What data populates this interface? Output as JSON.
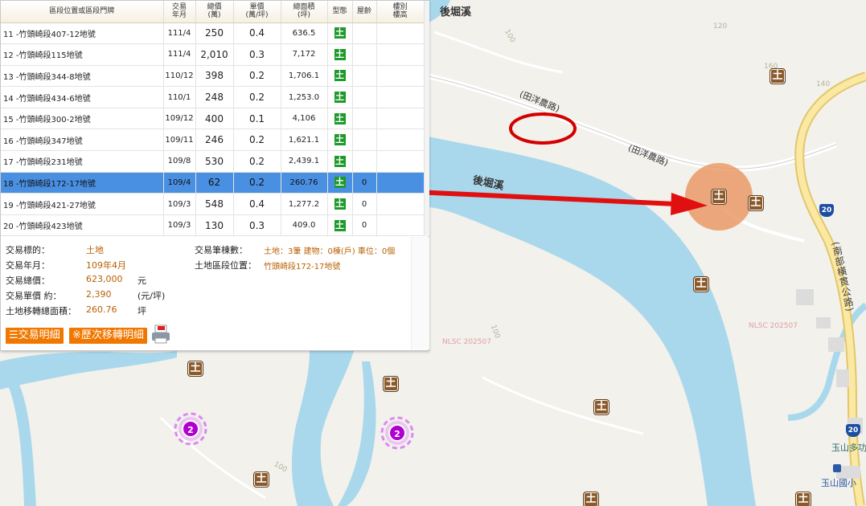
{
  "table": {
    "headers": [
      "區段位置或區段門牌",
      "交易\n年月",
      "總價\n(萬)",
      "單價\n(萬/坪)",
      "總面積\n(坪)",
      "型態",
      "屋齡",
      "樓別\n樓高"
    ],
    "rows": [
      {
        "addr": "11 -竹頭崎段407-12地號",
        "date": "111/4",
        "total": "250",
        "unit": "0.4",
        "area": "636.5",
        "type": "土",
        "age": "",
        "floor": ""
      },
      {
        "addr": "12 -竹頭崎段115地號",
        "date": "111/4",
        "total": "2,010",
        "unit": "0.3",
        "area": "7,172",
        "type": "土",
        "age": "",
        "floor": ""
      },
      {
        "addr": "13 -竹頭崎段344-8地號",
        "date": "110/12",
        "total": "398",
        "unit": "0.2",
        "area": "1,706.1",
        "type": "土",
        "age": "",
        "floor": ""
      },
      {
        "addr": "14 -竹頭崎段434-6地號",
        "date": "110/1",
        "total": "248",
        "unit": "0.2",
        "area": "1,253.0",
        "type": "土",
        "age": "",
        "floor": ""
      },
      {
        "addr": "15 -竹頭崎段300-2地號",
        "date": "109/12",
        "total": "400",
        "unit": "0.1",
        "area": "4,106",
        "type": "土",
        "age": "",
        "floor": ""
      },
      {
        "addr": "16 -竹頭崎段347地號",
        "date": "109/11",
        "total": "246",
        "unit": "0.2",
        "area": "1,621.1",
        "type": "土",
        "age": "",
        "floor": ""
      },
      {
        "addr": "17 -竹頭崎段231地號",
        "date": "109/8",
        "total": "530",
        "unit": "0.2",
        "area": "2,439.1",
        "type": "土",
        "age": "",
        "floor": ""
      },
      {
        "addr": "18 -竹頭崎段172-17地號",
        "date": "109/4",
        "total": "62",
        "unit": "0.2",
        "area": "260.76",
        "type": "土",
        "age": "0",
        "floor": ""
      },
      {
        "addr": "19 -竹頭崎段421-27地號",
        "date": "109/3",
        "total": "548",
        "unit": "0.4",
        "area": "1,277.2",
        "type": "土",
        "age": "0",
        "floor": ""
      },
      {
        "addr": "20 -竹頭崎段423地號",
        "date": "109/3",
        "total": "130",
        "unit": "0.3",
        "area": "409.0",
        "type": "土",
        "age": "0",
        "floor": ""
      }
    ]
  },
  "detail": {
    "target_label": "交易標的：",
    "target_value": "土地",
    "date_label": "交易年月：",
    "date_value": "109年4月",
    "total_label": "交易總價：",
    "total_value": "623,000",
    "total_unit": "元",
    "unit_label": "交易單價 約：",
    "unit_value": "2,390",
    "unit_unit": "(元/坪)",
    "area_label": "土地移轉總面積：",
    "area_value": "260.76",
    "area_unit": "坪",
    "count_label": "交易筆棟數：",
    "count_value": "土地：3筆 建物：0棟(戶) 車位：0個",
    "location_label": "土地區段位置：",
    "location_value": "竹頭崎段172-17地號"
  },
  "buttons": {
    "details": "交易明細",
    "history": "※歷次移轉明細"
  },
  "map": {
    "labels": {
      "river_top": "後堀溪",
      "river_mid": "後堀溪",
      "road_1": "(田洋農路)",
      "road_2": "(田洋農路)",
      "south_road": "(南部橫貫公路)",
      "route_20a": "20",
      "route_20b": "20",
      "nlsc_1": "NLSC 202507",
      "nlsc_2": "NLSC 202507",
      "poi_1": "玉山多功能",
      "poi_2": "玉山國小",
      "c100a": "100",
      "c120": "120",
      "c160": "160",
      "c140": "140",
      "c100b": "100",
      "c100c": "100"
    },
    "land_marker_glyph": "土",
    "cluster_count_1": "2",
    "cluster_count_2": "2"
  },
  "colors": {
    "selected_row": "#4a90e2",
    "type_icon": "#1d9a2a",
    "value_text": "#b85f00",
    "button": "#f07800",
    "river": "#a9d8ec",
    "arrow": "#e01010",
    "marker": "#8b5a2b",
    "cluster": "#b000d0"
  }
}
